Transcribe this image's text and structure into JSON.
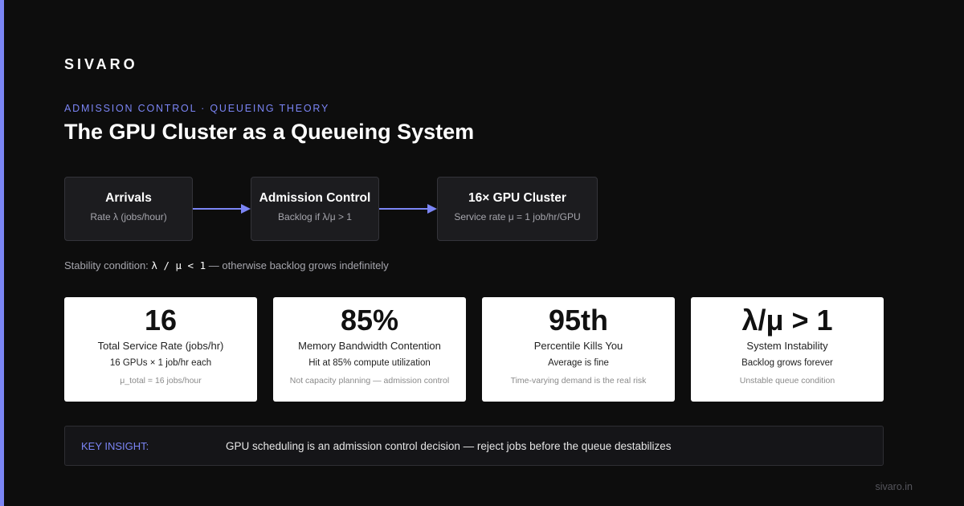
{
  "brand": {
    "name": "SIVARO"
  },
  "header": {
    "eyebrow": "ADMISSION CONTROL · QUEUEING THEORY",
    "title": "The GPU Cluster as a Queueing System"
  },
  "flow": {
    "arrow_color": "#7b85f5",
    "boxes": [
      {
        "title": "Arrivals",
        "subtitle": "Rate λ (jobs/hour)"
      },
      {
        "title": "Admission Control",
        "subtitle": "Backlog if λ/μ > 1"
      },
      {
        "title": "16× GPU Cluster",
        "subtitle": "Service rate μ = 1 job/hr/GPU"
      }
    ]
  },
  "stability": {
    "prefix": "Stability condition:",
    "formula": "λ / μ < 1",
    "suffix": "— otherwise backlog grows indefinitely"
  },
  "stats": [
    {
      "value": "16",
      "label": "Total Service Rate (jobs/hr)",
      "detail": "16 GPUs × 1 job/hr each",
      "note": "μ_total = 16 jobs/hour"
    },
    {
      "value": "85%",
      "label": "Memory Bandwidth Contention",
      "detail": "Hit at 85% compute utilization",
      "note": "Not capacity planning — admission control"
    },
    {
      "value": "95th",
      "label": "Percentile Kills You",
      "detail": "Average is fine",
      "note": "Time-varying demand is the real risk"
    },
    {
      "value": "λ/μ > 1",
      "label": "System Instability",
      "detail": "Backlog grows forever",
      "note": "Unstable queue condition"
    }
  ],
  "insight": {
    "label": "KEY INSIGHT:",
    "text": "GPU scheduling is an admission control decision — reject jobs before the queue destabilizes"
  },
  "footer": {
    "url": "sivaro.in"
  },
  "colors": {
    "accent": "#7b85f5",
    "background": "#0d0d0d",
    "card": "#ffffff",
    "box": "#1c1c1f"
  }
}
